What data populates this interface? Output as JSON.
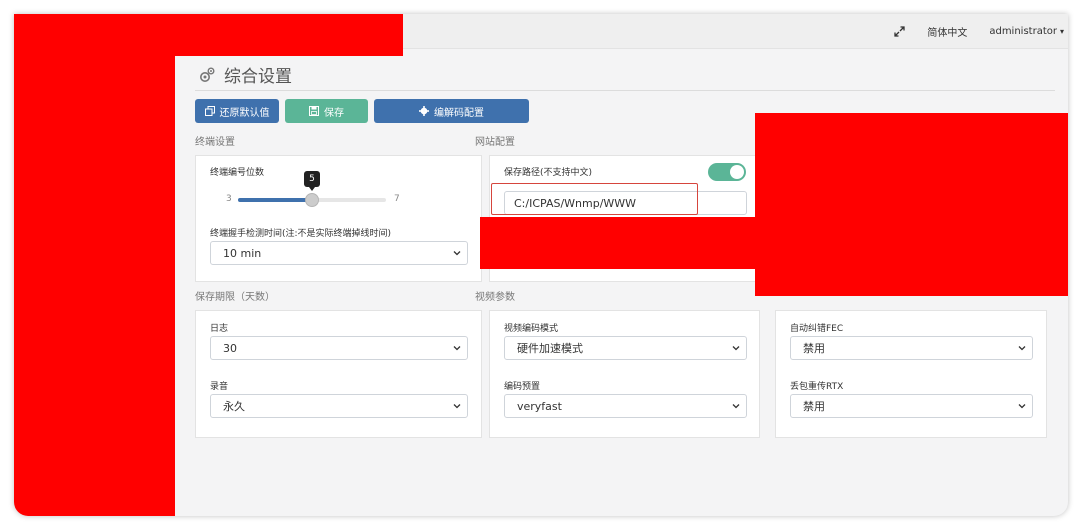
{
  "topbar": {
    "expand_icon": "expand-arrows-icon",
    "language": "简体中文",
    "user": "administrator",
    "user_caret": "▾"
  },
  "page": {
    "title": "综合设置",
    "title_icon": "gears-icon"
  },
  "toolbar": {
    "restore_label": "还原默认值",
    "save_label": "保存",
    "codec_label": "编解码配置"
  },
  "terminal": {
    "section": "终端设置",
    "id_digits_label": "终端编号位数",
    "slider": {
      "min": "3",
      "max": "7",
      "value": "5",
      "fraction": 0.5
    },
    "handshake_label": "终端握手检测时间(注:不是实际终端掉线时间)",
    "handshake_value": "10 min"
  },
  "site": {
    "section": "网站配置",
    "save_path_label": "保存路径(不支持中文)",
    "save_path_value": "C:/ICPAS/Wnmp/WWW",
    "toggle_on": true
  },
  "retention": {
    "section": "保存期限（天数）",
    "log_label": "日志",
    "log_value": "30",
    "audio_label": "录音",
    "audio_value": "永久"
  },
  "video": {
    "section": "视频参数",
    "mode_label": "视频编码模式",
    "mode_value": "硬件加速模式",
    "preset_label": "编码预置",
    "preset_value": "veryfast"
  },
  "network": {
    "fec_label": "自动纠错FEC",
    "fec_value": "禁用",
    "rtx_label": "丢包重传RTX",
    "rtx_value": "禁用"
  },
  "colors": {
    "primary": "#3f71ad",
    "success": "#5bb597",
    "highlight": "#d6453d",
    "redaction": "#ff0000"
  }
}
